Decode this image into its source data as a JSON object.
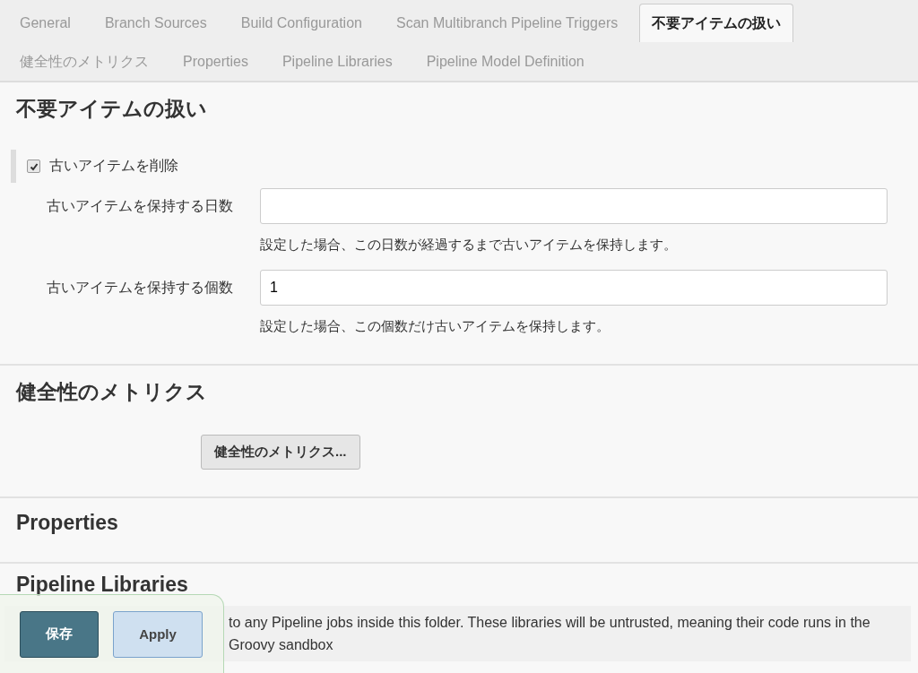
{
  "tabs": [
    {
      "label": "General",
      "selected": false
    },
    {
      "label": "Branch Sources",
      "selected": false
    },
    {
      "label": "Build Configuration",
      "selected": false
    },
    {
      "label": "Scan Multibranch Pipeline Triggers",
      "selected": false
    },
    {
      "label": "不要アイテムの扱い",
      "selected": true
    },
    {
      "label": "健全性のメトリクス",
      "selected": false
    },
    {
      "label": "Properties",
      "selected": false
    },
    {
      "label": "Pipeline Libraries",
      "selected": false
    },
    {
      "label": "Pipeline Model Definition",
      "selected": false
    }
  ],
  "orphan_section": {
    "title": "不要アイテムの扱い",
    "checkbox": {
      "label": "古いアイテムを削除",
      "checked": true
    },
    "fields": [
      {
        "label": "古いアイテムを保持する日数",
        "help": "設定した場合、この日数が経過するまで古いアイテムを保持します。"
      },
      {
        "label": "古いアイテムを保持する個数",
        "value": "1",
        "help": "設定した場合、この個数だけ古いアイテムを保持します。"
      }
    ]
  },
  "health_section": {
    "title": "健全性のメトリクス",
    "button": "健全性のメトリクス..."
  },
  "properties_section": {
    "title": "Properties"
  },
  "libraries_section": {
    "title": "Pipeline Libraries",
    "description": "to any Pipeline jobs inside this folder. These libraries will be untrusted, meaning their code runs in the Groovy sandbox"
  },
  "footer_buttons": [
    {
      "label": "保存",
      "kind": "primary"
    },
    {
      "label": "Apply",
      "kind": "secondary"
    }
  ]
}
